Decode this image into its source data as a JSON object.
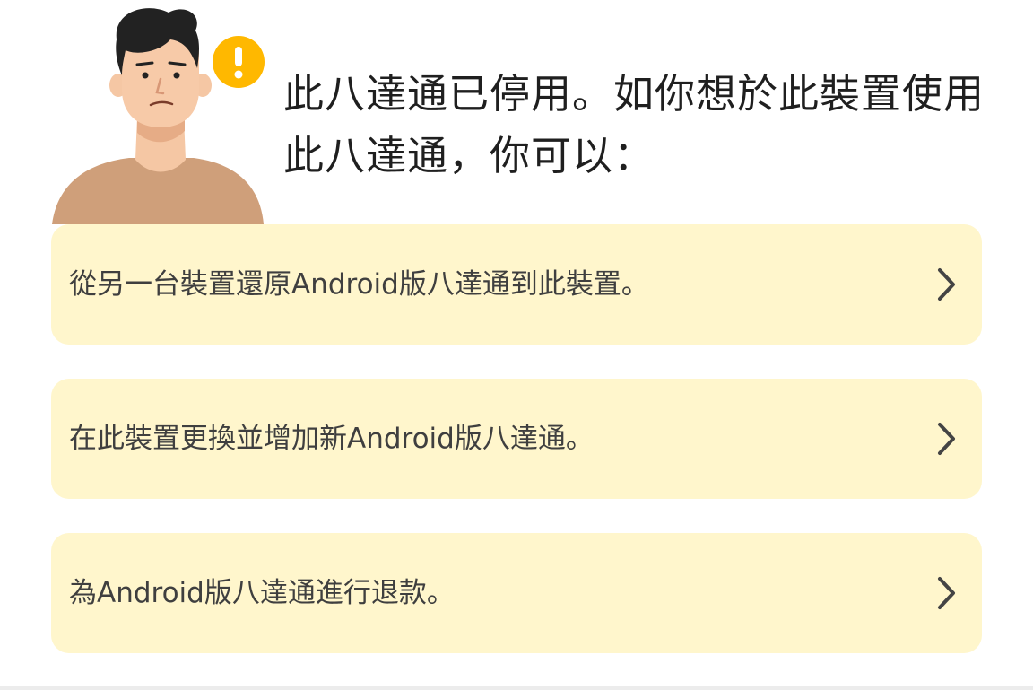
{
  "notice": {
    "title": "此八達通已停用。如你想於此裝置使用此八達通，你可以：",
    "illustration_icon": "person-with-warning-icon",
    "warning_color": "#ffb800"
  },
  "options": [
    {
      "label": "從另一台裝置還原Android版八達通到此裝置。",
      "icon": "chevron-right-icon"
    },
    {
      "label": "在此裝置更換並增加新Android版八達通。",
      "icon": "chevron-right-icon"
    },
    {
      "label": "為Android版八達通進行退款。",
      "icon": "chevron-right-icon"
    }
  ],
  "colors": {
    "option_background": "#fff6cc",
    "text": "#1f1f1f"
  }
}
